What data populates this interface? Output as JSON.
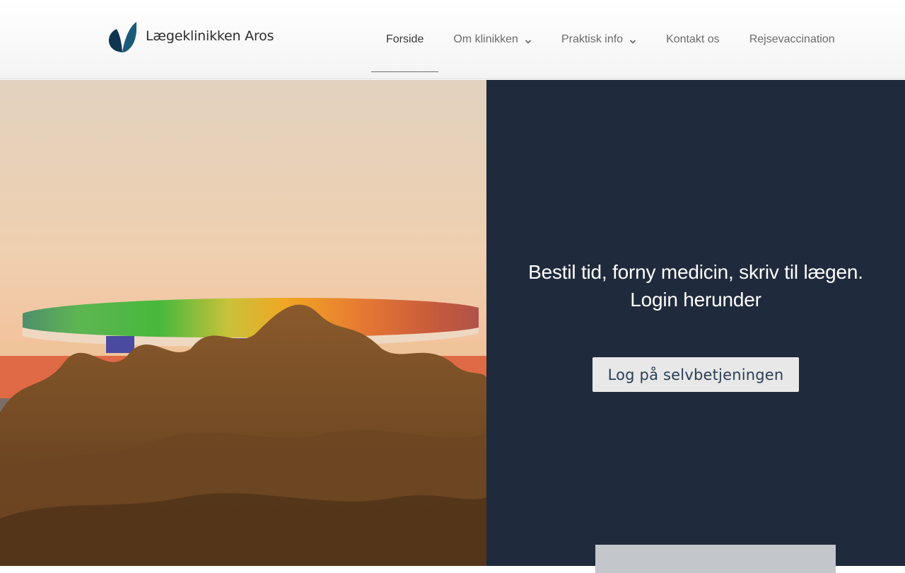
{
  "brand": {
    "name": "Lægeklinikken Aros",
    "logo_icon": "leaf-icon",
    "leaf_dark": "#123a52",
    "leaf_light": "#1c5a7a"
  },
  "nav": {
    "items": [
      {
        "label": "Forside",
        "active": true,
        "dropdown": false
      },
      {
        "label": "Om klinikken",
        "active": false,
        "dropdown": true
      },
      {
        "label": "Praktisk info",
        "active": false,
        "dropdown": true
      },
      {
        "label": "Kontakt os",
        "active": false,
        "dropdown": false
      },
      {
        "label": "Rejsevaccination",
        "active": false,
        "dropdown": false
      }
    ]
  },
  "hero": {
    "headline_line1": "Bestil tid, forny medicin, skriv til lægen.",
    "headline_line2": "Login herunder",
    "login_button": "Log på selvbetjeningen",
    "panel_color": "#1f2a3c"
  }
}
